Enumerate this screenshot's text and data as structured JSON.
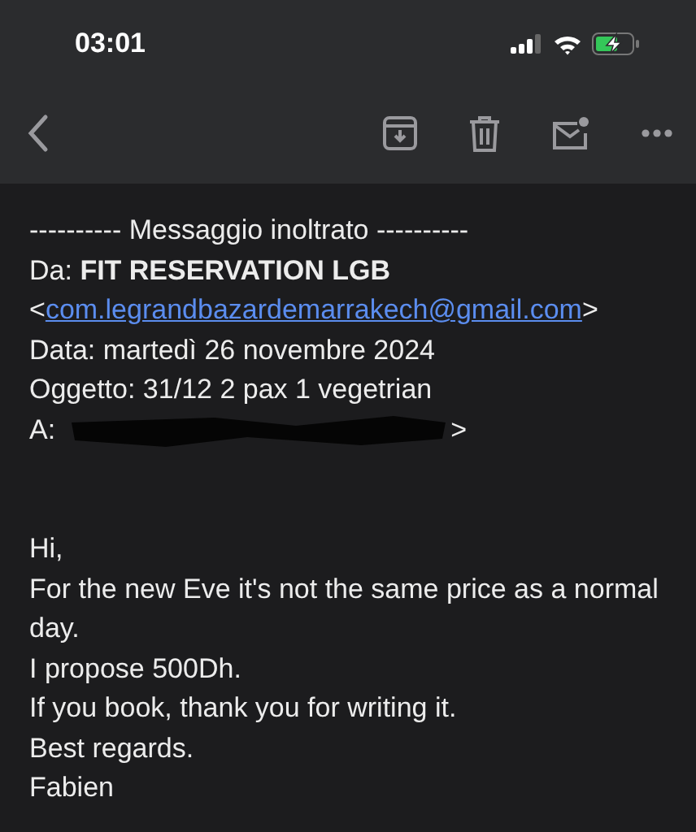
{
  "status_bar": {
    "time": "03:01",
    "battery_charging": true
  },
  "toolbar": {
    "actions": [
      {
        "kind": "archive"
      },
      {
        "kind": "trash"
      },
      {
        "kind": "unread"
      },
      {
        "kind": "more"
      }
    ]
  },
  "forward_header": {
    "separator": "---------- Messaggio inoltrato ----------",
    "from_label": "Da:",
    "from_name": "FIT RESERVATION LGB",
    "from_open": "<",
    "from_email": "com.legrandbazardemarrakech@gmail.com",
    "from_close": ">",
    "date_line": "Data: martedì 26 novembre 2024",
    "subject_line": "Oggetto: 31/12 2 pax 1 vegetrian",
    "to_label": "A:",
    "to_redacted": true,
    "to_end": ">"
  },
  "body": [
    "Hi,",
    "For the new Eve it's not the same price as a normal day.",
    "I propose 500Dh.",
    "If you book, thank you for writing it.",
    "Best regards.",
    "Fabien"
  ]
}
